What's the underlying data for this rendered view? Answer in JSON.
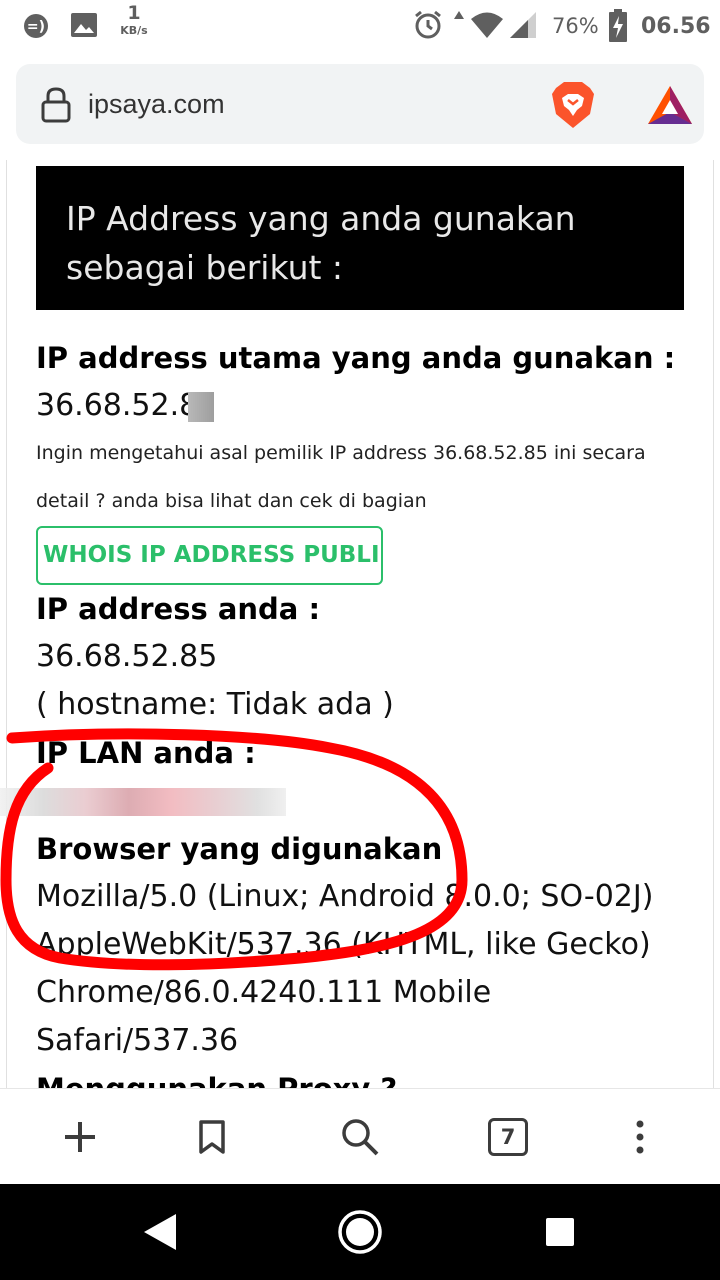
{
  "status_bar": {
    "net_speed_value": "1",
    "net_speed_unit": "KB/s",
    "battery": "76%",
    "time": "06.56"
  },
  "address_bar": {
    "url": "ipsaya.com"
  },
  "page": {
    "hero_text": "IP Address yang anda gunakan sebagai berikut :",
    "main_ip_heading": "IP address utama yang anda gunakan :",
    "main_ip_value": "36.68.52.8",
    "info_line1": "Ingin mengetahui asal pemilik IP address 36.68.52.85 ini secara",
    "info_line2": "detail ? anda bisa lihat dan cek di bagian",
    "whois_button": "WHOIS IP ADDRESS PUBLIK",
    "ip_heading": "IP address anda :",
    "ip_value": "36.68.52.85",
    "hostname": "( hostname: Tidak ada )",
    "lan_heading": "IP LAN anda :",
    "browser_heading": "Browser yang digunakan :",
    "browser_line1": "Mozilla/5.0 (Linux; Android 8.0.0; SO-02J)",
    "browser_line2": "AppleWebKit/537.36 (KHTML, like Gecko)",
    "browser_line3": "Chrome/86.0.4240.111 Mobile",
    "browser_line4": "Safari/537.36",
    "proxy_heading": "Menggunakan Proxy ?"
  },
  "toolbar": {
    "tab_count": "7"
  },
  "icons": {
    "status": [
      "dnd-icon",
      "image-icon",
      "alarm-icon",
      "data-arrows-icon",
      "wifi-icon",
      "signal-icon",
      "battery-charging-icon"
    ],
    "toolbar": [
      "new-tab-icon",
      "bookmark-icon",
      "search-icon",
      "tab-switcher-icon",
      "more-menu-icon"
    ],
    "nav": [
      "back-icon",
      "home-icon",
      "recents-icon"
    ]
  },
  "colors": {
    "whois_green": "#2bbf6a",
    "annotation_red": "#ff0000",
    "hero_bg": "#000000",
    "brave_orange": "#fb542b"
  }
}
